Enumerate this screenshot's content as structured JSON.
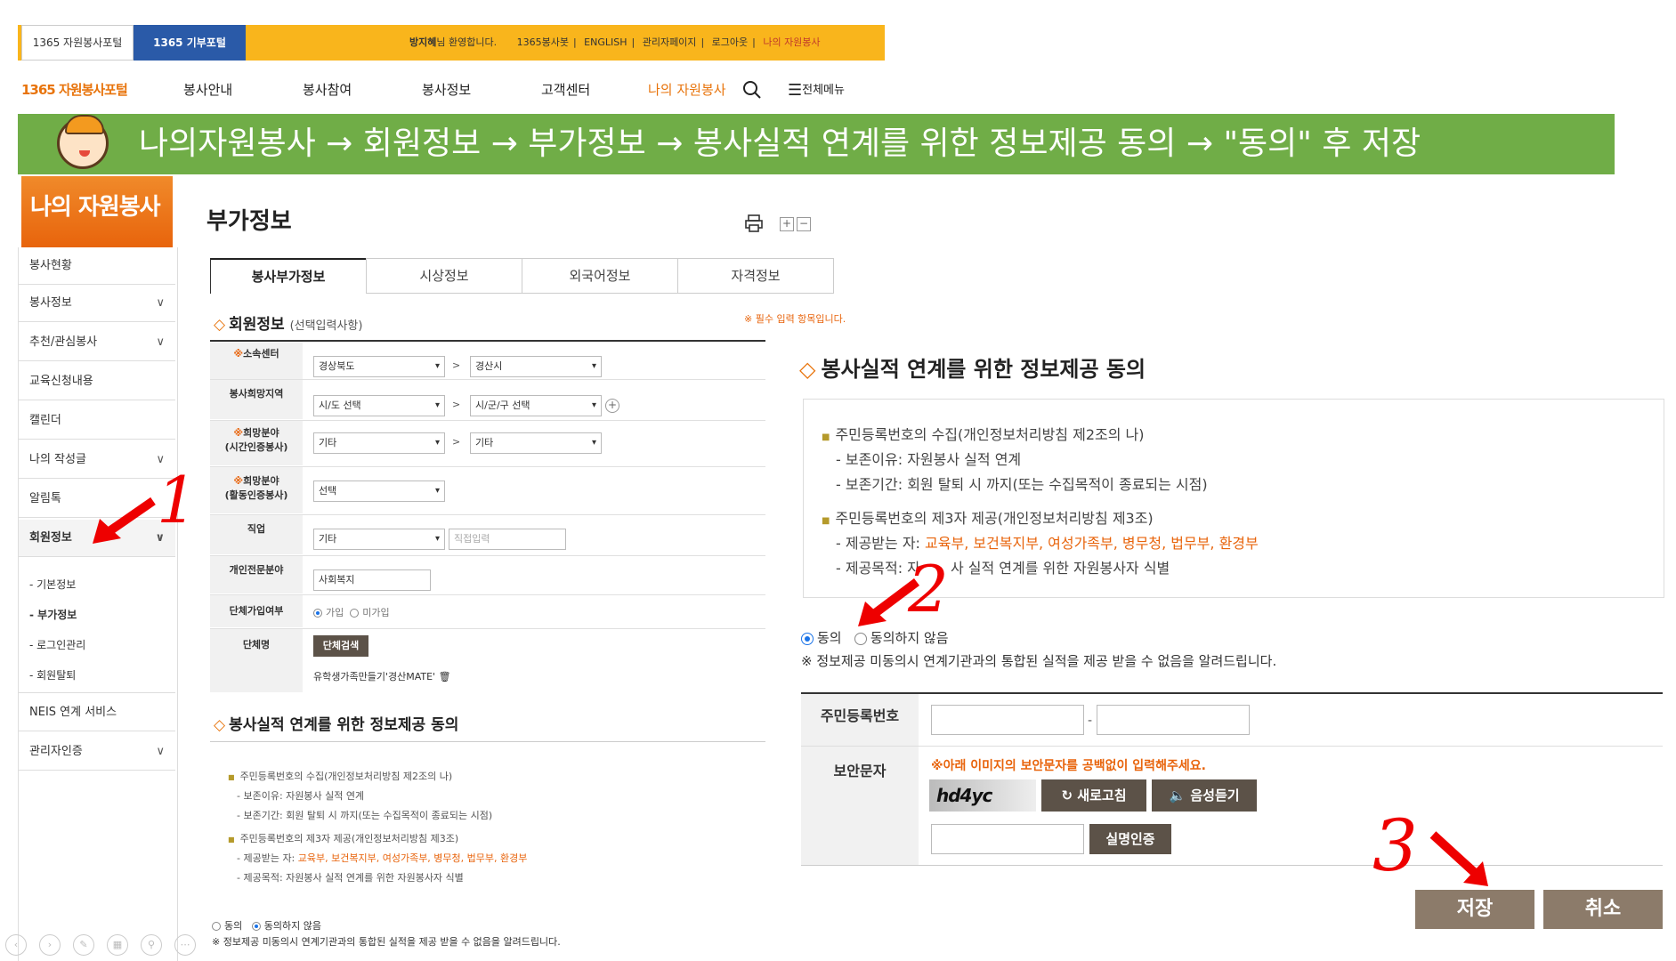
{
  "topbar": {
    "portal_tab": "1365 자원봉사포털",
    "donate_tab": "1365 기부포털",
    "welcome_name": "방지혜",
    "welcome_suffix": "님 환영합니다.",
    "links": [
      "1365봉사봇",
      "ENGLISH",
      "관리자페이지",
      "로그아웃",
      "나의 자원봉사"
    ]
  },
  "gnb": {
    "logo": "1365 자원봉사포털",
    "items": [
      "봉사안내",
      "봉사참여",
      "봉사정보",
      "고객센터",
      "나의 자원봉사"
    ],
    "all_menu": "전체메뉴"
  },
  "banner": {
    "text": "나의자원봉사 → 회원정보 → 부가정보 → 봉사실적 연계를 위한 정보제공 동의 → \"동의\" 후 저장",
    "color": "#70ad47"
  },
  "sidebar": {
    "title": "나의 자원봉사",
    "items": [
      "봉사현황",
      "봉사정보",
      "추천/관심봉사",
      "교육신청내용",
      "캘린더",
      "나의 작성글",
      "알림톡",
      "회원정보",
      "NEIS 연계 서비스",
      "관리자인증"
    ],
    "subitems": [
      "- 기본정보",
      "- 부가정보",
      "- 로그인관리",
      "- 회원탈퇴"
    ]
  },
  "content": {
    "title": "부가정보",
    "tabs": [
      "봉사부가정보",
      "시상정보",
      "외국어정보",
      "자격정보"
    ],
    "member_section": "회원정보",
    "member_section_note": "(선택입력사항)",
    "required_note": "※ 필수 입력 항목입니다.",
    "form": {
      "center_label": "소속센터",
      "center_sido": "경상북도",
      "center_sigungu": "경산시",
      "region_label": "봉사희망지역",
      "region_sido": "시/도 선택",
      "region_sigungu": "시/군/구 선택",
      "field_time_label1": "희망분야",
      "field_time_label2": "(시간인증봉사)",
      "field_time_1": "기타",
      "field_time_2": "기타",
      "field_act_label1": "희망분야",
      "field_act_label2": "(활동인증봉사)",
      "field_act": "선택",
      "job_label": "직업",
      "job_value": "기타",
      "job_direct_placeholder": "직접입력",
      "expert_label": "개인전문분야",
      "expert_value": "사회복지",
      "group_join_label": "단체가입여부",
      "group_join_yes": "가입",
      "group_join_no": "미가입",
      "group_name_label": "단체명",
      "group_search_btn": "단체검색",
      "group_name_value": "유학생가족만들기'경산MATE'",
      "star": "※",
      "gt": ">"
    },
    "agree_section": "봉사실적 연계를 위한 정보제공 동의",
    "agree": {
      "item1_title": "주민등록번호의 수집(개인정보처리방침 제2조의 나)",
      "item1_reason": "- 보존이유: 자원봉사 실적 연계",
      "item1_period": "- 보존기간: 회원 탈퇴 시 까지(또는 수집목적이 종료되는 시점)",
      "item2_title": "주민등록번호의 제3자 제공(개인정보처리방침 제3조)",
      "item2_receivers_label": "- 제공받는 자: ",
      "item2_receivers": "교육부, 보건복지부, 여성가족부, 병무청, 법무부, 환경부",
      "item2_purpose": "- 제공목적: 자원봉사 실적 연계를 위한 자원봉사자 식별",
      "agree_label": "동의",
      "disagree_label": "동의하지 않음",
      "notice": "※ 정보제공 미동의시 연계기관과의 통합된 실적을 제공 받을 수 없음을 알려드립니다."
    }
  },
  "zoom": {
    "title": "봉사실적 연계를 위한 정보제공 동의",
    "item2_purpose_a": "- 제공목적: 자",
    "item2_purpose_b": "사 실적 연계를 위한 자원봉사자 식별",
    "rrn_label": "주민등록번호",
    "rrn_dash": "-",
    "security_label": "보안문자",
    "security_note": "※아래 이미지의 보안문자를 공백없이 입력해주세요.",
    "captcha_text": "hd4yc",
    "refresh_btn": "새로고침",
    "listen_btn": "음성듣기",
    "verify_btn": "실명인증",
    "save_btn": "저장",
    "cancel_btn": "취소"
  },
  "annotations": [
    "1",
    "2",
    "3"
  ],
  "presenter_controls": [
    "back-icon",
    "forward-icon",
    "pen-icon",
    "slides-icon",
    "zoom-icon",
    "more-icon"
  ]
}
